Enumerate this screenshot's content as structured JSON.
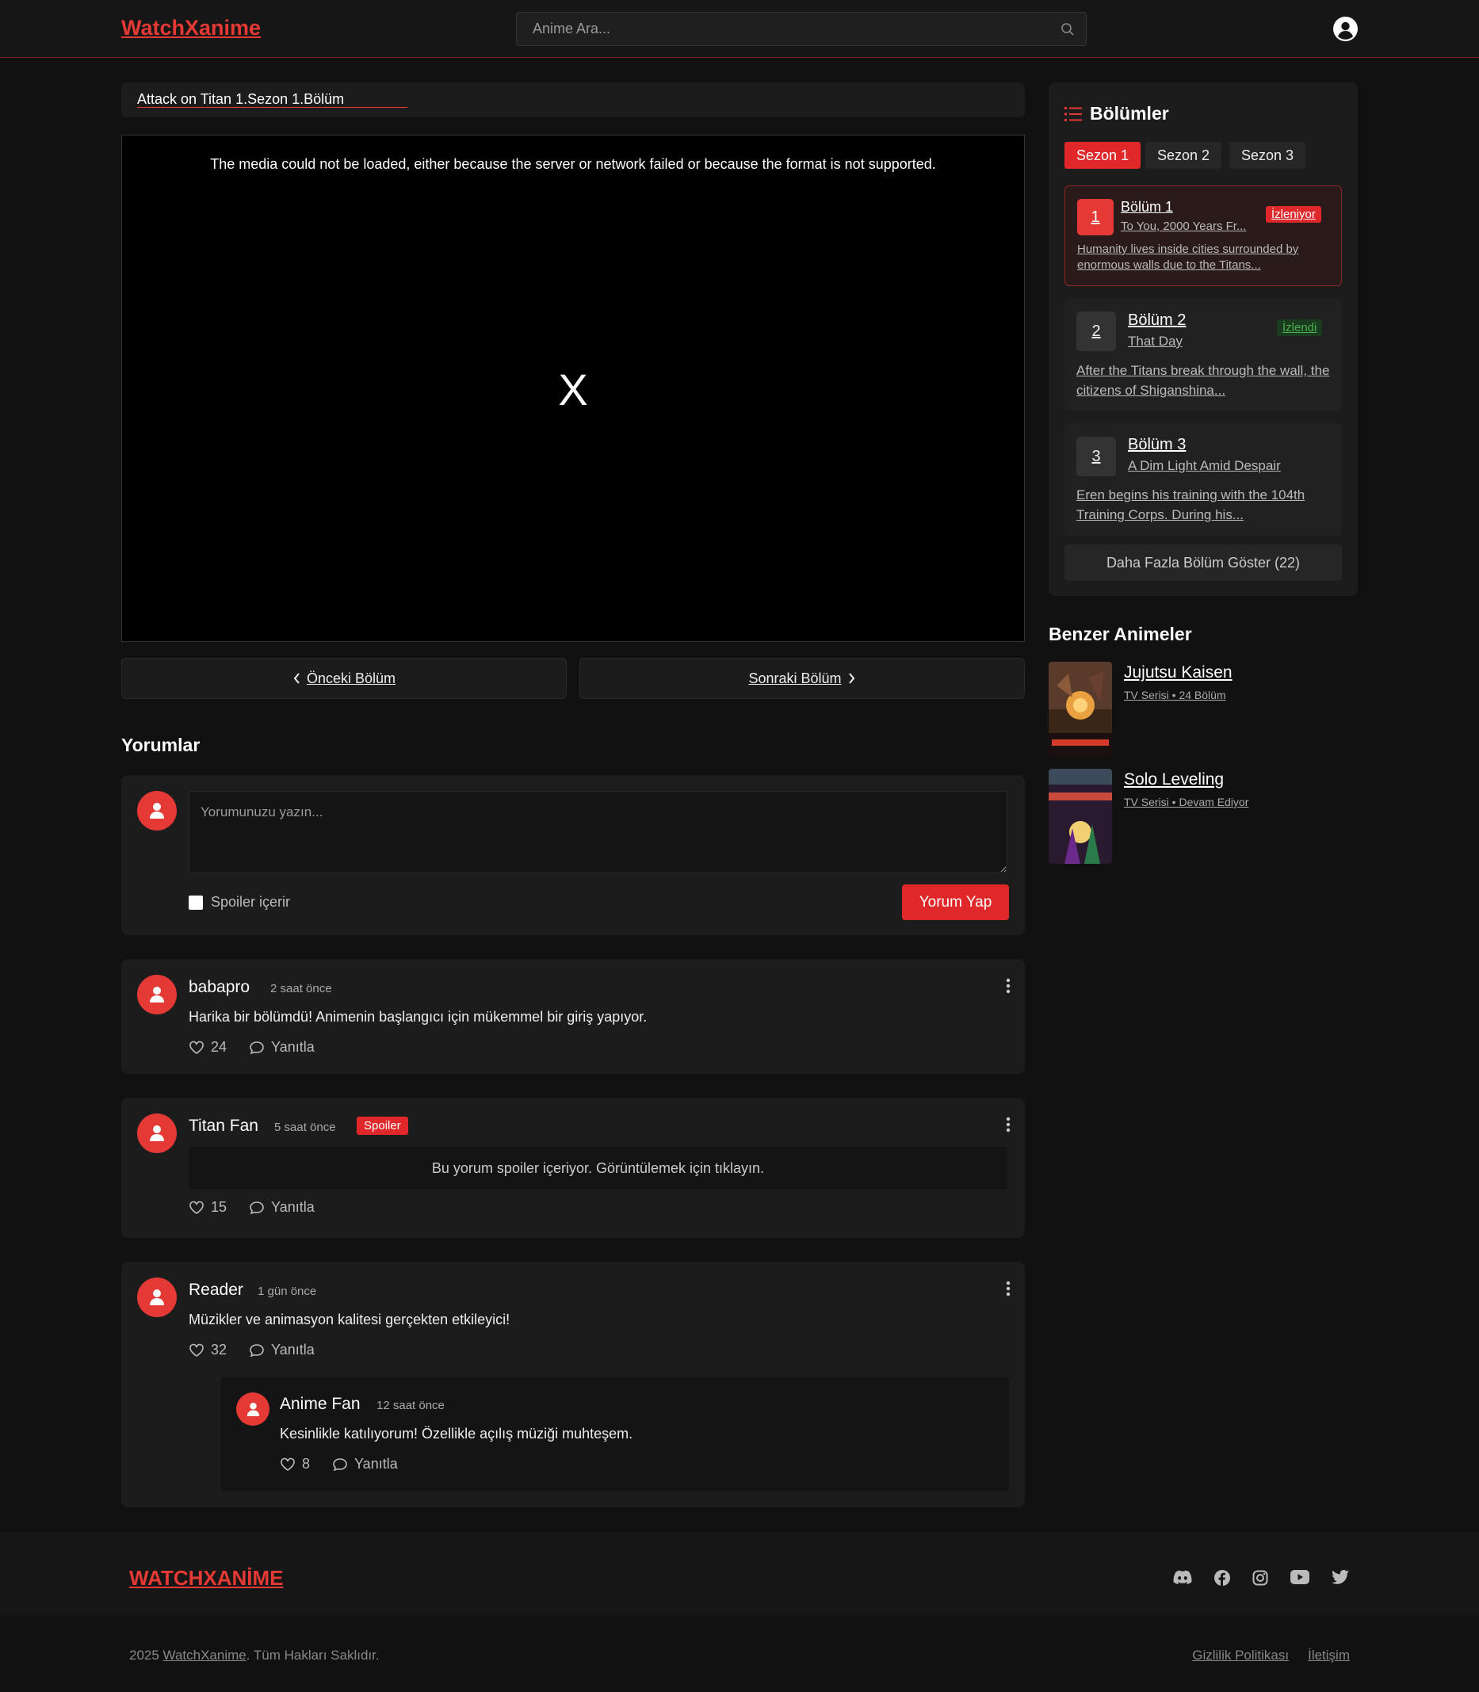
{
  "header": {
    "logo": "WatchXanime",
    "search_placeholder": "Anime Ara..."
  },
  "breadcrumb": "Attack on Titan 1.Sezon 1.Bölüm",
  "player": {
    "error": "The media could not be loaded, either because the server or network failed or because the format is not supported.",
    "close": "X"
  },
  "nav": {
    "prev": "Önceki Bölüm",
    "next": "Sonraki Bölüm"
  },
  "comments": {
    "title": "Yorumlar",
    "placeholder": "Yorumunuzu yazın...",
    "spoiler_label": "Spoiler içerir",
    "submit": "Yorum Yap",
    "reply_label": "Yanıtla",
    "items": [
      {
        "name": "babapro",
        "time": "2 saat önce",
        "text": "Harika bir bölümdü! Animenin başlangıcı için mükemmel bir giriş yapıyor.",
        "likes": "24"
      },
      {
        "name": "Titan Fan",
        "time": "5 saat önce",
        "badge": "Spoiler",
        "text": "Bu yorum spoiler içeriyor. Görüntülemek için tıklayın.",
        "likes": "15"
      },
      {
        "name": "Reader",
        "time": "1 gün önce",
        "text": "Müzikler ve animasyon kalitesi gerçekten etkileyici!",
        "likes": "32",
        "reply": {
          "name": "Anime Fan",
          "time": "12 saat önce",
          "text": "Kesinlikle katılıyorum! Özellikle açılış müziği muhteşem.",
          "likes": "8"
        }
      }
    ]
  },
  "episodes": {
    "title": "Bölümler",
    "seasons": [
      "Sezon 1",
      "Sezon 2",
      "Sezon 3"
    ],
    "items": [
      {
        "num": "1",
        "title": "Bölüm 1",
        "subtitle": "To You, 2000 Years Fr...",
        "desc": "Humanity lives inside cities surrounded by enormous walls due to the Titans...",
        "status": "İzleniyor",
        "status_color": "#e0282a"
      },
      {
        "num": "2",
        "title": "Bölüm 2",
        "subtitle": "That Day",
        "desc": "After the Titans break through the wall, the citizens of Shiganshina...",
        "status": "İzlendi",
        "status_color": "#2e7d32"
      },
      {
        "num": "3",
        "title": "Bölüm 3",
        "subtitle": "A Dim Light Amid Despair",
        "desc": "Eren begins his training with the 104th Training Corps. During his..."
      }
    ],
    "more": "Daha Fazla Bölüm Göster (22)"
  },
  "similar": {
    "title": "Benzer Animeler",
    "items": [
      {
        "title": "Jujutsu Kaisen",
        "meta": "TV Serisi • 24 Bölüm"
      },
      {
        "title": "Solo Leveling",
        "meta": "TV Serisi • Devam Ediyor"
      }
    ]
  },
  "footer": {
    "logo": "WATCHXANİME",
    "copy_prefix": "2025 ",
    "copy_link": "WatchXanime",
    "copy_suffix": ". Tüm Hakları Saklıdır.",
    "privacy": "Gizlilik Politikası",
    "contact": "İletişim"
  },
  "colors": {
    "accent": "#e53935",
    "bg": "#111111",
    "panel": "#1c1c1c"
  },
  "icons": [
    "search-icon",
    "user-icon",
    "chevron-left-icon",
    "chevron-right-icon",
    "list-icon",
    "heart-icon",
    "comment-icon",
    "more-vertical-icon",
    "discord-icon",
    "facebook-icon",
    "instagram-icon",
    "youtube-icon",
    "twitter-icon"
  ]
}
